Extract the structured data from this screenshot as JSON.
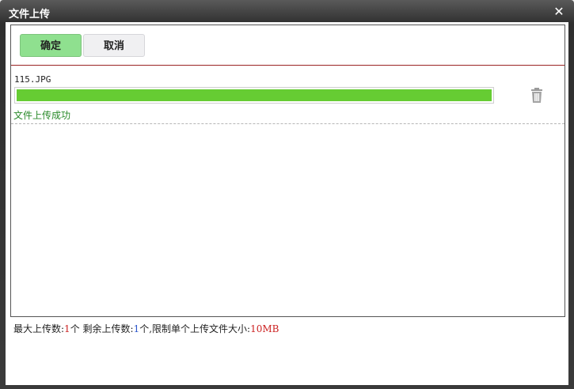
{
  "dialog": {
    "title": "文件上传",
    "close_icon": "close-icon"
  },
  "toolbar": {
    "confirm_label": "确定",
    "cancel_label": "取消"
  },
  "file": {
    "name": "115.JPG",
    "progress_percent": 100,
    "status": "文件上传成功",
    "delete_icon": "trash-icon"
  },
  "footer": {
    "max_label": "最大上传数:",
    "max_value": "1",
    "max_unit": "个  ",
    "remain_label": "剩余上传数:",
    "remain_value": "1",
    "remain_unit": "个,限制单个上传文件大小:",
    "size_limit": "10MB"
  },
  "colors": {
    "confirm_bg": "#8fe08f",
    "progress": "#66cc33",
    "success_text": "#2a8a2a",
    "divider": "#9b2323"
  }
}
